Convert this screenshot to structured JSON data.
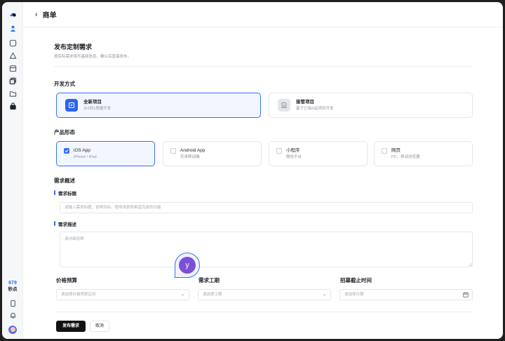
{
  "header": {
    "back_icon": "chevron-left-icon",
    "title": "商单"
  },
  "sidebar": {
    "icons": [
      "logo-icon",
      "user-icon",
      "home-icon",
      "cloud-icon",
      "inbox-icon",
      "copy-icon",
      "folder-icon",
      "bag-icon"
    ],
    "points_value": "679",
    "points_label": "秒点",
    "bottom_icons": [
      "phone-icon",
      "bell-icon",
      "avatar"
    ]
  },
  "form": {
    "title": "发布定制需求",
    "subtitle": "按实际需求填写基础信息，确认后直接发布。"
  },
  "dev_mode": {
    "section_title": "开发方式",
    "options": [
      {
        "name": "全新项目",
        "desc": "从0到1搭建开发",
        "icon": "new-project-icon",
        "selected": true
      },
      {
        "name": "接管项目",
        "desc": "基于已有R站项目开发",
        "icon": "takeover-project-icon",
        "selected": false
      }
    ]
  },
  "product_form": {
    "section_title": "产品形态",
    "options": [
      {
        "name": "iOS App",
        "desc": "iPhone / iPad",
        "selected": true
      },
      {
        "name": "Android App",
        "desc": "安卓移动端",
        "selected": false
      },
      {
        "name": "小程序",
        "desc": "微信平台",
        "selected": false
      },
      {
        "name": "网页",
        "desc": "PC、移动浏览器",
        "selected": false
      }
    ]
  },
  "overview": {
    "section_title": "需求概述",
    "title_label": "需求标题",
    "title_placeholder": "请输入需求标题，说明目标、使用场景和希望完成的功能",
    "desc_label": "需求描述",
    "desc_placeholder": "请详细说明"
  },
  "fields": {
    "budget_label": "价格预算",
    "budget_placeholder": "请选择价格预算区间",
    "period_label": "需求工期",
    "period_placeholder": "请选择工期",
    "deadline_label": "招募截止时间",
    "deadline_placeholder": "请选择日期"
  },
  "actions": {
    "publish": "发布需求",
    "cancel": "取消"
  },
  "bubble": {
    "letter": "y"
  },
  "colors": {
    "accent": "#3370ff",
    "primary_button": "#111111",
    "bubble_avatar": "#7b4fd6"
  }
}
